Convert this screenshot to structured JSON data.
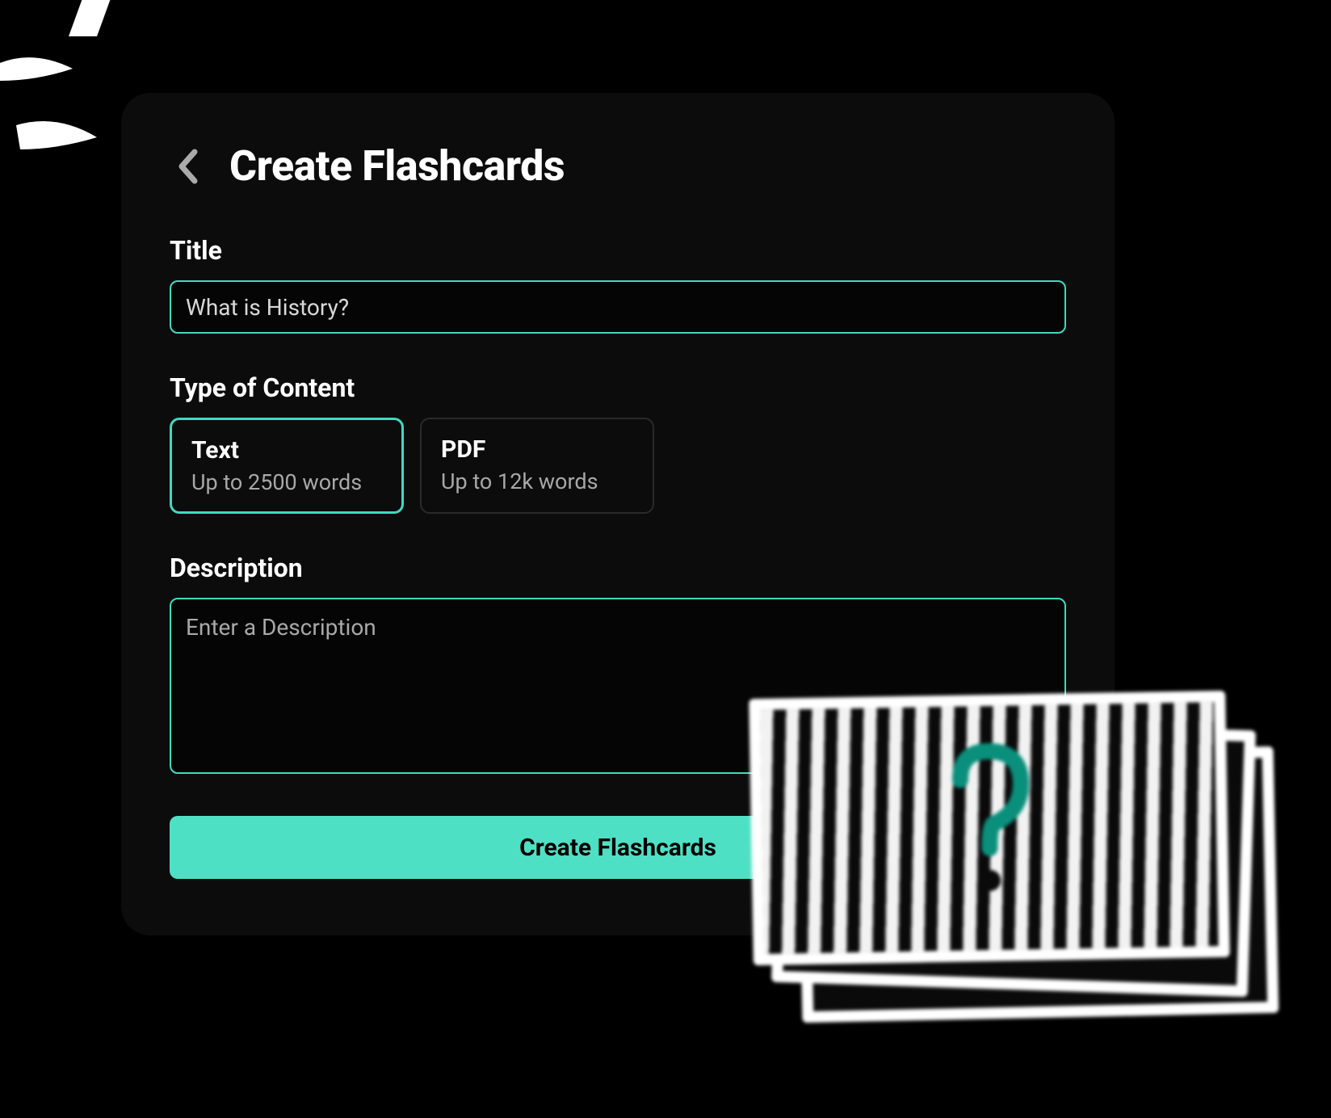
{
  "header": {
    "title": "Create Flashcards"
  },
  "colors": {
    "accent": "#3edbc0",
    "background": "#000000",
    "card_bg": "#0c0c0c"
  },
  "form": {
    "title_label": "Title",
    "title_value": "What is History?",
    "content_type_label": "Type of Content",
    "options": [
      {
        "title": "Text",
        "subtitle": "Up to 2500 words",
        "selected": true
      },
      {
        "title": "PDF",
        "subtitle": "Up to 12k words",
        "selected": false
      }
    ],
    "description_label": "Description",
    "description_value": "",
    "description_placeholder": "Enter a Description",
    "submit_label": "Create Flashcards"
  },
  "icons": {
    "back": "chevron-left-icon",
    "decoration_flashcard": "flashcard-stack-icon",
    "decoration_scribble": "sparkle-scribble-icon"
  }
}
